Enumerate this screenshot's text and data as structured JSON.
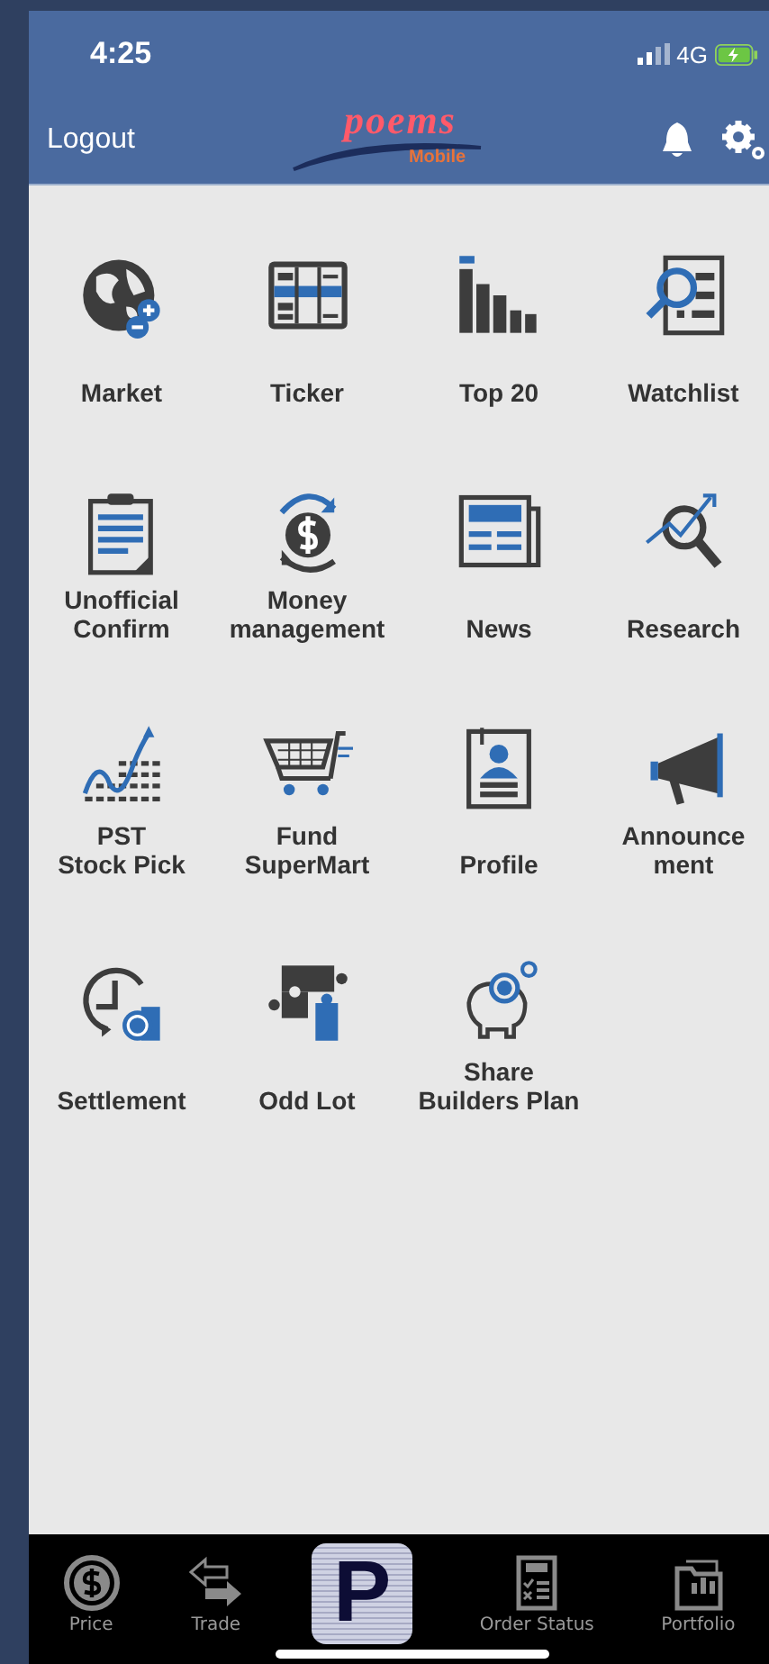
{
  "status_bar": {
    "time": "4:25",
    "network": "4G"
  },
  "header": {
    "logout": "Logout",
    "logo_word": "poems",
    "logo_sub": "Mobile"
  },
  "menu": [
    {
      "label": "Market"
    },
    {
      "label": "Ticker"
    },
    {
      "label": "Top 20"
    },
    {
      "label": "Watchlist"
    },
    {
      "label": "Unofficial\nConfirm"
    },
    {
      "label": "Money\nmanagement"
    },
    {
      "label": "News"
    },
    {
      "label": "Research"
    },
    {
      "label": "PST\nStock Pick"
    },
    {
      "label": "Fund\nSuperMart"
    },
    {
      "label": "Profile"
    },
    {
      "label": "Announce\nment"
    },
    {
      "label": "Settlement"
    },
    {
      "label": "Odd Lot"
    },
    {
      "label": "Share\nBuilders Plan"
    }
  ],
  "tab_bar": [
    {
      "kind": "tab",
      "label": "Price"
    },
    {
      "kind": "tab",
      "label": "Trade"
    },
    {
      "kind": "logo",
      "label": "P"
    },
    {
      "kind": "tab",
      "label": "Order Status"
    },
    {
      "kind": "tab",
      "label": "Portfolio"
    }
  ]
}
